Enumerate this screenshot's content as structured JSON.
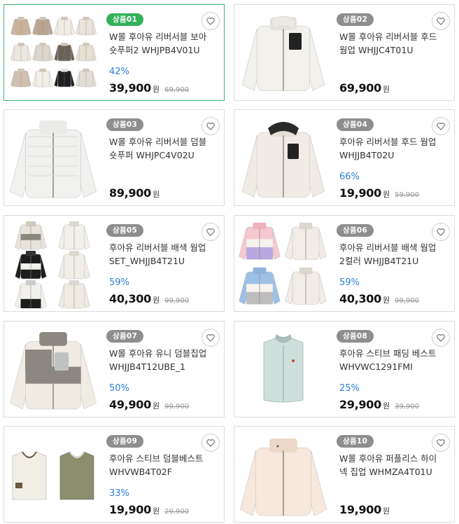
{
  "products": [
    {
      "badge": "상품01",
      "title": "W몰 후아유 리버서블 보아 숏푸퍼2 WHJPB4V01U",
      "discount": "42%",
      "price": "39,900",
      "currency": "원",
      "original": "69,900",
      "thumb": "multi12",
      "selected": true
    },
    {
      "badge": "상품02",
      "title": "W몰 후아유 리버서블 후드 웜업 WHJJC4T01U",
      "discount": "",
      "price": "69,900",
      "currency": "원",
      "original": "",
      "thumb": "fleece-white"
    },
    {
      "badge": "상품03",
      "title": "W몰 후아유 리버서블 덤블 숏푸퍼 WHJPC4V02U",
      "discount": "",
      "price": "89,900",
      "currency": "원",
      "original": "",
      "thumb": "puffer"
    },
    {
      "badge": "상품04",
      "title": "후아유 리버서블 후드 웜업 WHJJB4T02U",
      "discount": "66%",
      "price": "19,900",
      "currency": "원",
      "original": "59,900",
      "thumb": "fleece-hood"
    },
    {
      "badge": "상품05",
      "title": "후아유 리버서블 배색 웜업 SET_WHJJB4T21U",
      "discount": "59%",
      "price": "40,300",
      "currency": "원",
      "original": "99,900",
      "thumb": "multi6-dark"
    },
    {
      "badge": "상품06",
      "title": "후아유 리버서블 배색 웜업 2컬러 WHJJB4T21U",
      "discount": "59%",
      "price": "40,300",
      "currency": "원",
      "original": "99,900",
      "thumb": "multi4-pastel"
    },
    {
      "badge": "상품07",
      "title": "W몰 후아유 유니 덤블집업 WHJJB4T12UBE_1",
      "discount": "50%",
      "price": "49,900",
      "currency": "원",
      "original": "99,900",
      "thumb": "fleece-gray"
    },
    {
      "badge": "상품08",
      "title": "후아유 스티브 패딩 베스트 WHVWC1291FMI",
      "discount": "25%",
      "price": "29,900",
      "currency": "원",
      "original": "39,900",
      "thumb": "vest-mint"
    },
    {
      "badge": "상품09",
      "title": "후아유 스티브 덤블베스트 WHVWB4T02F",
      "discount": "33%",
      "price": "19,900",
      "currency": "원",
      "original": "29,900",
      "thumb": "vest-pair"
    },
    {
      "badge": "상품10",
      "title": "W몰 후아유 퍼플리스 하이넥 집업 WHMZA4T01U",
      "discount": "",
      "price": "19,900",
      "currency": "원",
      "original": "",
      "thumb": "fleece-beige"
    }
  ],
  "icons": {
    "wishlist": "heart-outline-icon"
  },
  "colors": {
    "selected_border": "#3cb371",
    "selected_badge": "#33b15a",
    "badge": "#8e8e8e",
    "discount": "#2b7fd9"
  }
}
